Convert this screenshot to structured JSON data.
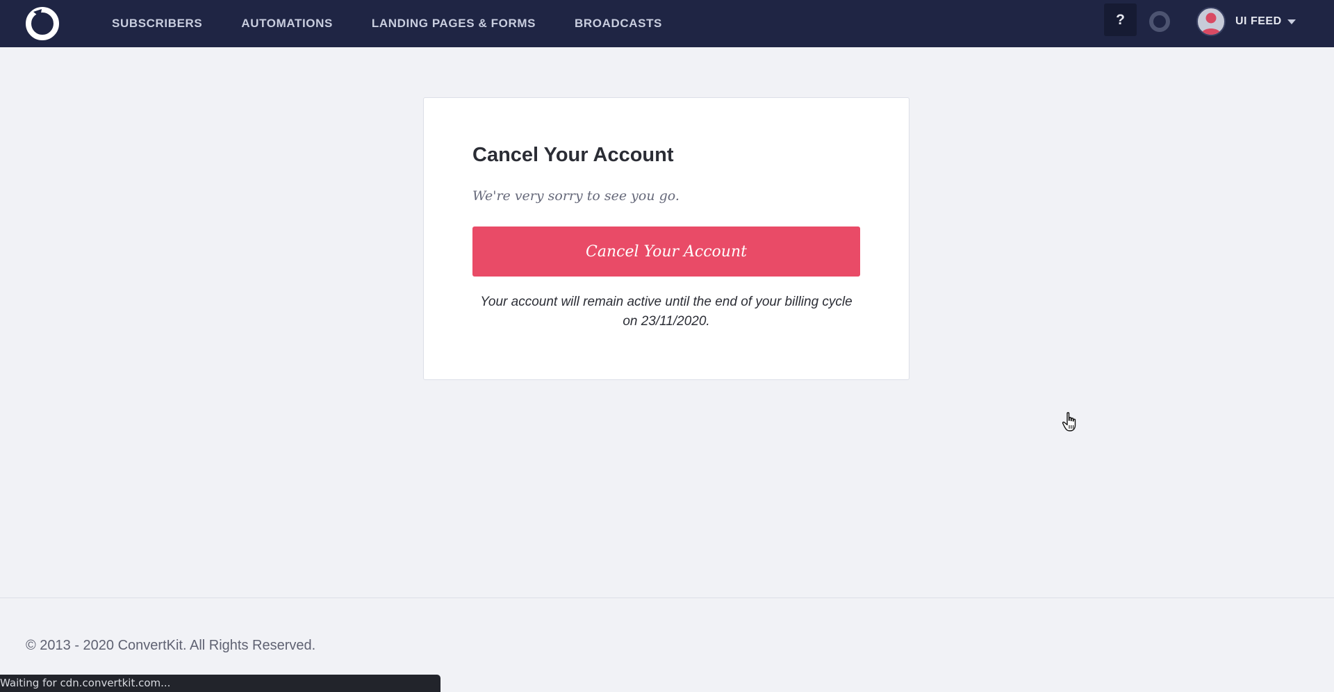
{
  "nav": {
    "items": [
      {
        "label": "SUBSCRIBERS"
      },
      {
        "label": "AUTOMATIONS"
      },
      {
        "label": "LANDING PAGES & FORMS"
      },
      {
        "label": "BROADCASTS"
      }
    ],
    "help_label": "?",
    "account_name": "UI FEED"
  },
  "cancel_card": {
    "title": "Cancel Your Account",
    "subtitle": "We're very sorry to see you go.",
    "button_label": "Cancel Your Account",
    "note": "Your account will remain active until the end of your billing cycle on 23/11/2020."
  },
  "footer": {
    "copyright": "© 2013 - 2020 ConvertKit. All Rights Reserved."
  },
  "browser_status": "Waiting for cdn.convertkit.com...",
  "colors": {
    "nav_background": "#1f2544",
    "page_background": "#f1f2f6",
    "danger_button": "#e94b67",
    "card_background": "#ffffff"
  },
  "icons": {
    "logo": "convertkit-logo-icon",
    "status": "status-ring-icon",
    "avatar": "user-avatar-icon",
    "caret": "caret-down-icon",
    "cursor": "hand-pointer-cursor-icon"
  }
}
